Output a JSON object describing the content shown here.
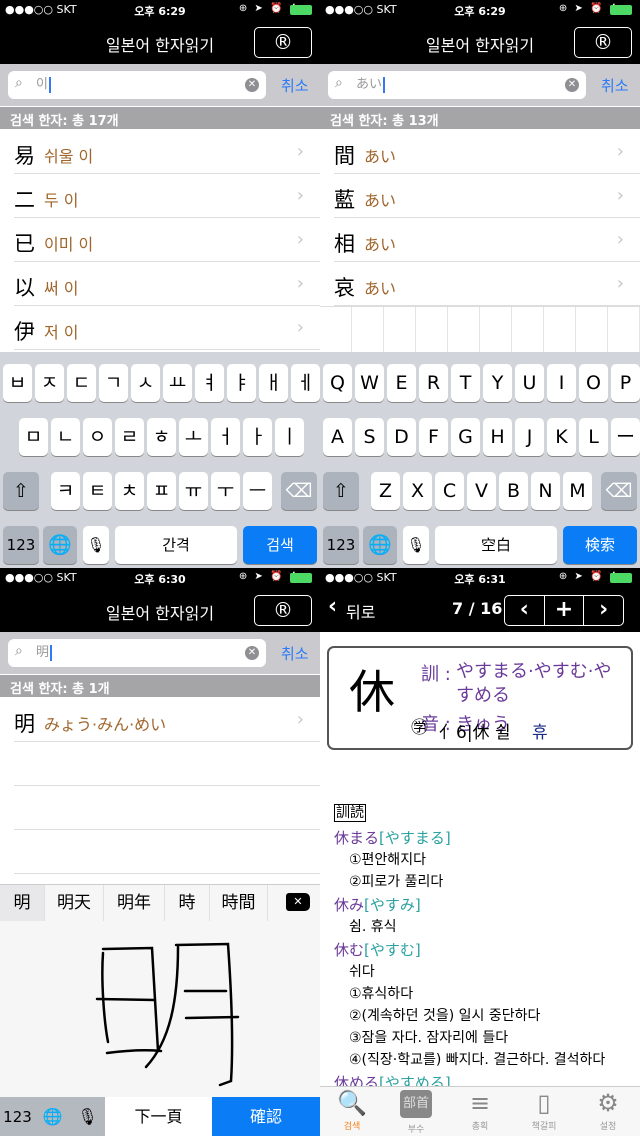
{
  "status": {
    "carrier": "●●●○○ SKT",
    "icons": "⊕ ➤ ⏰ ✱",
    "times": [
      "오후 6:29",
      "오후 6:29",
      "오후 6:30",
      "오후 6:31"
    ]
  },
  "app": {
    "title": "일본어 한자읽기",
    "r_button": "®"
  },
  "screens": [
    {
      "search_value": "이",
      "cancel": "취소",
      "header": "검색 한자: 총 17개",
      "rows": [
        {
          "kanji": "易",
          "reading": "쉬울 이"
        },
        {
          "kanji": "二",
          "reading": "두 이"
        },
        {
          "kanji": "已",
          "reading": "이미 이"
        },
        {
          "kanji": "以",
          "reading": "써 이"
        },
        {
          "kanji": "伊",
          "reading": "저 이"
        }
      ]
    },
    {
      "search_value": "あい",
      "cancel": "취소",
      "header": "검색 한자: 총 13개",
      "rows": [
        {
          "kanji": "間",
          "reading": "あい"
        },
        {
          "kanji": "藍",
          "reading": "あい"
        },
        {
          "kanji": "相",
          "reading": "あい"
        },
        {
          "kanji": "哀",
          "reading": "あい"
        }
      ]
    },
    {
      "search_value": "明",
      "cancel": "취소",
      "header": "검색 한자: 총 1개",
      "rows": [
        {
          "kanji": "明",
          "reading": "みょう·みん·めい"
        }
      ]
    }
  ],
  "keyboard_ko": {
    "row1": [
      "ㅂ",
      "ㅈ",
      "ㄷ",
      "ㄱ",
      "ㅅ",
      "ㅛ",
      "ㅕ",
      "ㅑ",
      "ㅐ",
      "ㅔ"
    ],
    "row2": [
      "ㅁ",
      "ㄴ",
      "ㅇ",
      "ㄹ",
      "ㅎ",
      "ㅗ",
      "ㅓ",
      "ㅏ",
      "ㅣ"
    ],
    "row3": [
      "ㅋ",
      "ㅌ",
      "ㅊ",
      "ㅍ",
      "ㅠ",
      "ㅜ",
      "ㅡ"
    ],
    "num": "123",
    "space": "간격",
    "action": "검색"
  },
  "keyboard_en": {
    "row1": [
      "Q",
      "W",
      "E",
      "R",
      "T",
      "Y",
      "U",
      "I",
      "O",
      "P"
    ],
    "row2": [
      "A",
      "S",
      "D",
      "F",
      "G",
      "H",
      "J",
      "K",
      "L",
      "ー"
    ],
    "row3": [
      "Z",
      "X",
      "C",
      "V",
      "B",
      "N",
      "M"
    ],
    "num": "123",
    "space": "空白",
    "action": "検索"
  },
  "handwriting": {
    "candidates": [
      "明",
      "明天",
      "明年",
      "時",
      "時間"
    ],
    "num": "123",
    "next": "下一頁",
    "confirm": "確認"
  },
  "detail": {
    "back": "뒤로",
    "page": "7 / 16",
    "kanji": "休",
    "kun_label": "訓 :",
    "kun": "やすまる·やすむ·やすめる",
    "on_label": "音 :",
    "on": "きゅう",
    "edu_mark": "㊫",
    "radical_info": "亻6|休 쉴",
    "korean_reading": "휴",
    "section": "訓読",
    "entries": [
      {
        "word": "休まる",
        "kana": "[やすまる]",
        "meanings": [
          "①편안해지다",
          "②피로가 풀리다"
        ]
      },
      {
        "word": "休み",
        "kana": "[やすみ]",
        "meanings": [
          "쉼. 휴식"
        ]
      },
      {
        "word": "休む",
        "kana": "[やすむ]",
        "meanings": [
          "쉬다",
          "①휴식하다",
          "②(계속하던 것을) 일시 중단하다",
          "③잠을 자다. 잠자리에 들다",
          "④(직장·학교를) 빠지다. 결근하다. 결석하다"
        ]
      },
      {
        "word": "休める",
        "kana": "[やすめる]",
        "meanings": []
      }
    ]
  },
  "tabbar": [
    {
      "label": "검색",
      "icon": "search-icon",
      "active": true
    },
    {
      "label": "부수",
      "icon": "radical-icon"
    },
    {
      "label": "총획",
      "icon": "stroke-count-icon"
    },
    {
      "label": "책갈피",
      "icon": "bookmark-icon"
    },
    {
      "label": "설정",
      "icon": "gear-icon"
    }
  ],
  "colors": {
    "accent": "#2d7cf6",
    "reading": "#a0652b",
    "kun": "#6a3a9a",
    "kana": "#2aa1a0",
    "tab_active": "#f7821b"
  }
}
